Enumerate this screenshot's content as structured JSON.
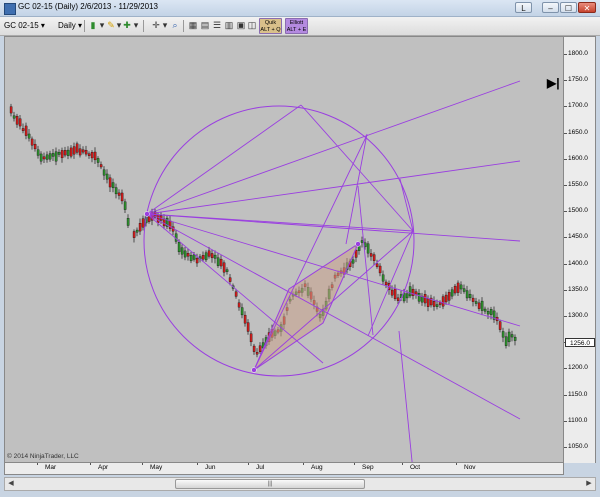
{
  "window": {
    "title": "GC 02-15 (Daily)  2/6/2013 - 11/29/2013",
    "buttons": {
      "layout": "L",
      "minimize": "–",
      "maximize": "☐",
      "close": "✕"
    }
  },
  "toolbar": {
    "instrument": "GC 02-15",
    "interval": "Daily",
    "quick_btn": [
      "Quik",
      "ALT + Q"
    ],
    "elliott_btn": [
      "Elliott",
      "ALT + E"
    ],
    "dropdown_glyph": "▾"
  },
  "icons": {
    "app": "app-icon",
    "bar-type": "bar-chart-icon",
    "pencil": "pencil-icon",
    "crosshair": "crosshair-icon",
    "plus": "zoom-in-icon",
    "grid": "data-box-icon",
    "props": "properties-icon",
    "list1": "list-icon",
    "list2": "list-alt-icon",
    "misc": "template-icon",
    "misc2": "share-icon",
    "cursor": "cursor-icon",
    "zoom": "zoom-icon"
  },
  "chart": {
    "copyright": "© 2014 NinjaTrader, LLC",
    "last_price": "1256.0",
    "goto_end_glyph": "▶|",
    "price_labels": [
      "1800.0",
      "1750.0",
      "1700.0",
      "1650.0",
      "1600.0",
      "1550.0",
      "1500.0",
      "1450.0",
      "1400.0",
      "1350.0",
      "1300.0",
      "1250.0",
      "1200.0",
      "1150.0",
      "1100.0",
      "1050.0"
    ],
    "month_labels": [
      "Mar",
      "Apr",
      "May",
      "Jun",
      "Jul",
      "Aug",
      "Sep",
      "Oct",
      "Nov"
    ],
    "colors": {
      "background": "#c0c0c0",
      "drawing": "#9a3fe0",
      "up_candle": "#2e8b2e",
      "down_candle": "#c81e1e",
      "wedge_fill": "#c8a08a"
    }
  },
  "scrollbar": {
    "left_arrow": "◀",
    "right_arrow": "▶",
    "thumb_grip": "|||"
  }
}
